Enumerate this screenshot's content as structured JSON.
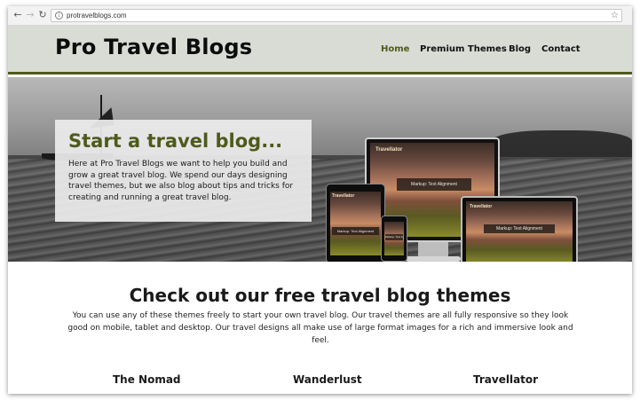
{
  "browser": {
    "url": "protravelblogs.com",
    "back_icon": "arrow-left-icon",
    "forward_icon": "arrow-right-icon",
    "reload_icon": "reload-icon",
    "info_icon": "info-icon",
    "bookmark_icon": "star-icon"
  },
  "site": {
    "logo": "Pro Travel Blogs",
    "nav": [
      {
        "label": "Home",
        "active": true
      },
      {
        "label": "Premium Themes",
        "active": false
      },
      {
        "label": "Blog",
        "active": false
      },
      {
        "label": "Contact",
        "active": false
      }
    ],
    "accent_color": "#4e5a1c",
    "header_bg": "#d8dcd5"
  },
  "hero": {
    "heading": "Start a travel blog...",
    "text": "Here at Pro Travel Blogs we want to help you build and grow a great travel blog. We spend our days designing travel themes, but we also blog about tips and tricks for creating and running a great travel blog.",
    "device_site_name": "Travellator",
    "device_caption": "Markup: Text Alignment"
  },
  "content": {
    "title": "Check out our free travel blog themes",
    "description": "You can use any of these themes freely to start your own travel blog. Our travel themes are all fully responsive so they look good on mobile, tablet and desktop. Our travel designs all make use of large format images for a rich and immersive look and feel.",
    "themes": [
      {
        "name": "The Nomad"
      },
      {
        "name": "Wanderlust"
      },
      {
        "name": "Travellator"
      }
    ]
  }
}
